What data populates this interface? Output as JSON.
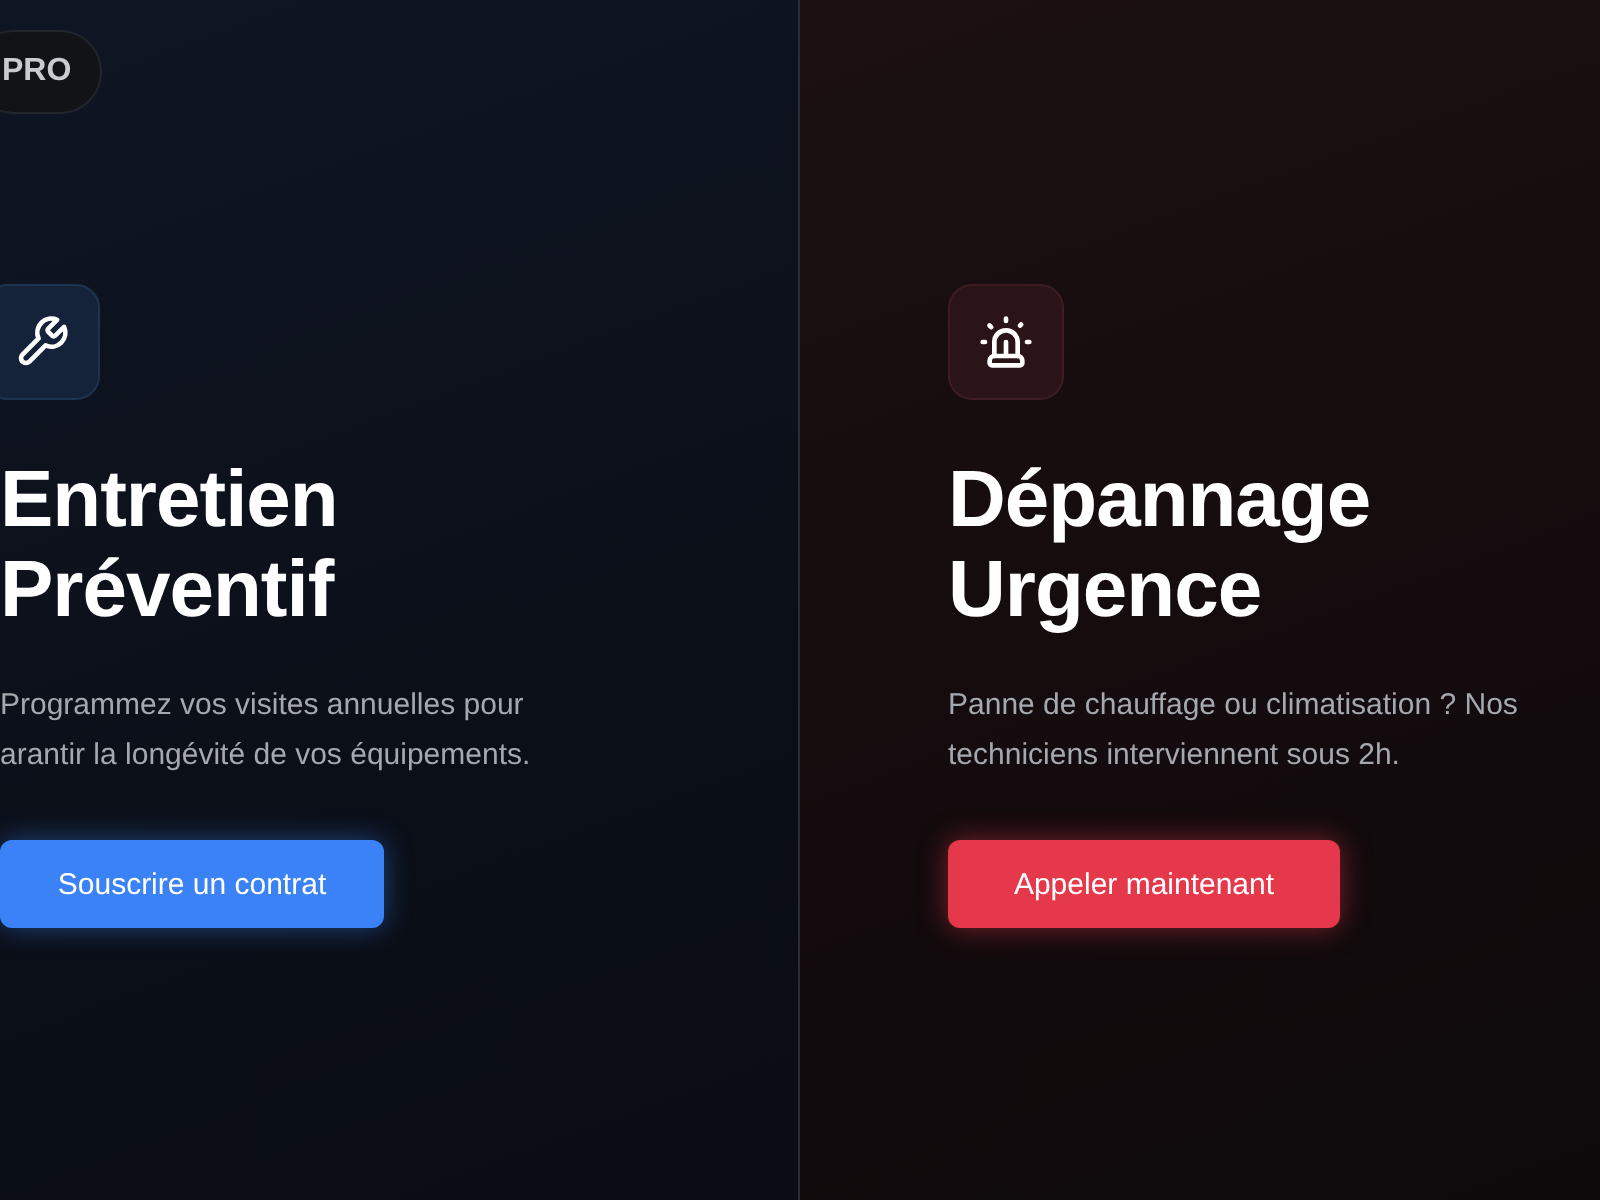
{
  "badge": {
    "label": "PRO"
  },
  "panels": [
    {
      "kind": "maintenance",
      "title_lines": [
        "Entretien",
        "Préventif"
      ],
      "description_lines": [
        "Programmez vos visites annuelles pour",
        "arantir la longévité de vos équipements."
      ],
      "button": "Souscrire un contrat"
    },
    {
      "kind": "emergency",
      "title_lines": [
        "Dépannage",
        "Urgence"
      ],
      "description_lines": [
        "Panne de chauffage ou climatisation ? Nos",
        "techniciens interviennent sous 2h."
      ],
      "button": "Appeler maintenant"
    }
  ]
}
